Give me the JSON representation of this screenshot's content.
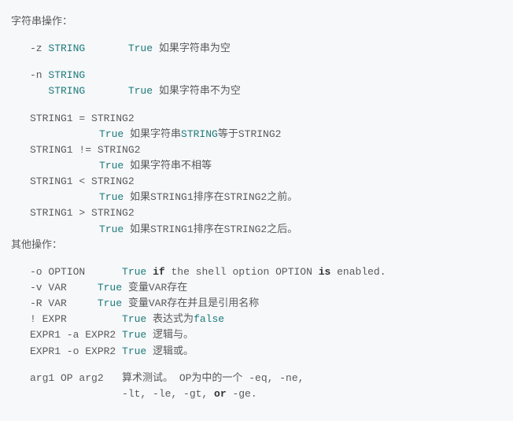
{
  "headers": {
    "string_ops": "字符串操作：",
    "other_ops": "其他操作："
  },
  "z": {
    "flag": "-z ",
    "arg": "STRING",
    "gap": "       ",
    "kw": "True",
    "desc": " 如果字符串为空"
  },
  "n": {
    "flag": "-n ",
    "arg": "STRING",
    "line2arg": "STRING",
    "line2pad": "   ",
    "gap": "       ",
    "kw": "True",
    "desc": " 如果字符串不为空"
  },
  "eq": {
    "expr": "STRING1 = STRING2",
    "kw": "True",
    "desc1": " 如果字符串",
    "var": "STRING",
    "desc2": "等于STRING2"
  },
  "ne": {
    "expr": "STRING1 != STRING2",
    "kw": "True",
    "desc": " 如果字符串不相等"
  },
  "lt": {
    "expr": "STRING1 < STRING2",
    "kw": "True",
    "desc": " 如果STRING1排序在STRING2之前。"
  },
  "gt": {
    "expr": "STRING1 > STRING2",
    "kw": "True",
    "desc": " 如果STRING1排序在STRING2之后。"
  },
  "o": {
    "flag": "-o OPTION      ",
    "kw": "True",
    "sp1": " ",
    "if": "if",
    "mid": " the shell option OPTION ",
    "is": "is",
    "end": " enabled."
  },
  "v": {
    "flag": "-v VAR     ",
    "kw": "True",
    "desc": " 变量VAR存在"
  },
  "R": {
    "flag": "-R VAR     ",
    "kw": "True",
    "desc": " 变量VAR存在并且是引用名称"
  },
  "not": {
    "flag": "! EXPR         ",
    "kw": "True",
    "desc": " 表达式为",
    "false": "false"
  },
  "and": {
    "flag": "EXPR1 -a EXPR2 ",
    "kw": "True",
    "desc": " 逻辑与。"
  },
  "orx": {
    "flag": "EXPR1 -o EXPR2 ",
    "kw": "True",
    "desc": " 逻辑或。"
  },
  "arith": {
    "line1": "arg1 OP arg2   算术测试。 OP为中的一个 -eq, -ne,",
    "line2a": "               -lt, -le, -gt, ",
    "or": "or",
    "line2b": " -ge."
  }
}
